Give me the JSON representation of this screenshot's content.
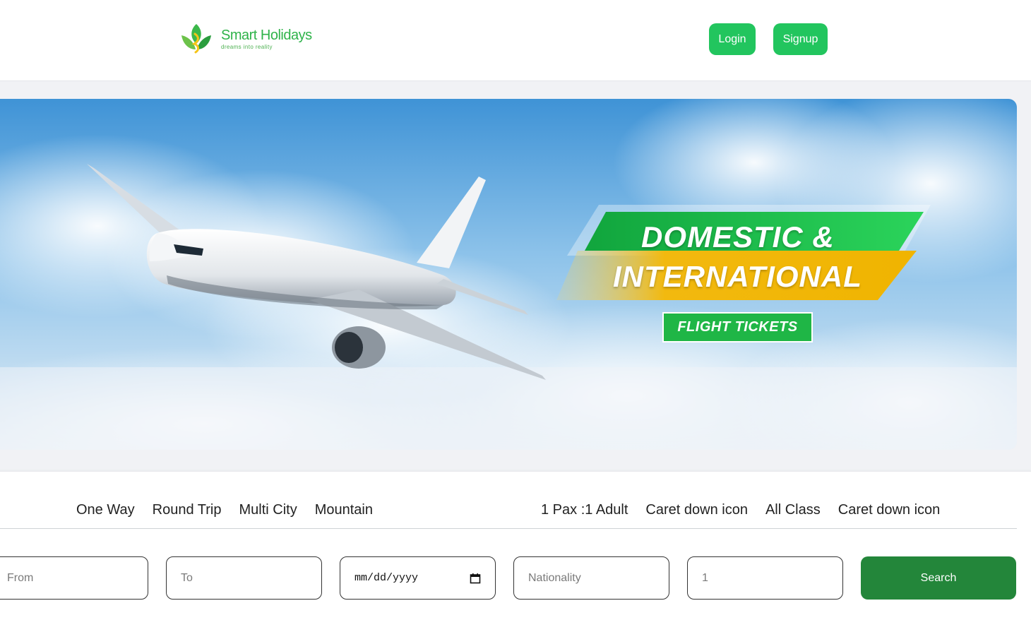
{
  "header": {
    "logo_name": "Smart Holidays",
    "logo_tagline": "dreams into reality",
    "login_label": "Login",
    "signup_label": "Signup"
  },
  "banner": {
    "line1": "DOMESTIC &",
    "line2": "INTERNATIONAL",
    "badge": "FLIGHT TICKETS"
  },
  "search": {
    "trip_types": [
      "One Way",
      "Round Trip",
      "Multi City",
      "Mountain"
    ],
    "pax_label": "1 Pax :1 Adult",
    "pax_caret": "Caret down icon",
    "class_label": "All Class",
    "class_caret": "Caret down icon",
    "from_placeholder": "From",
    "to_placeholder": "To",
    "date_placeholder": "mm/dd/yyyy",
    "nationality_placeholder": "Nationality",
    "pax_count_placeholder": "1",
    "search_label": "Search"
  },
  "colors": {
    "brand_green": "#22c55e",
    "search_button": "#23863a",
    "banner_sky": "#8ec3ea",
    "ribbon_green": "#1fb646",
    "ribbon_yellow": "#f2b90f"
  },
  "icons": {
    "calendar": "calendar-icon",
    "logo": "leaf-logo-icon"
  }
}
